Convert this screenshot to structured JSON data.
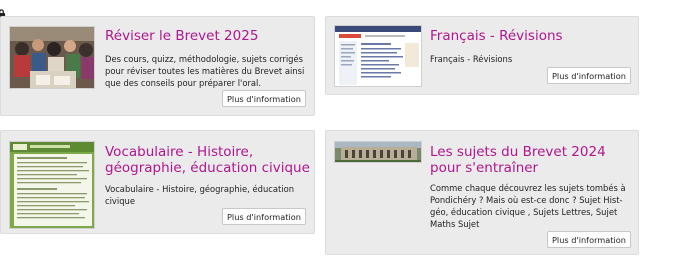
{
  "cards": [
    {
      "title": "Réviser le Brevet 2025",
      "description": "Des cours, quizz, méthodologie, sujets corrigés pour réviser toutes les matières du Brevet ainsi que des conseils pour préparer l'oral.",
      "button": "Plus d'information",
      "thumbnail": "photo-students-group"
    },
    {
      "title": "Français - Révisions",
      "description": "Français - Révisions",
      "button": "Plus d'information",
      "thumbnail": "website-screenshot"
    },
    {
      "title": "Vocabulaire - Histoire, géographie, éducation civique",
      "description": "Vocabulaire - Histoire, géographie, éducation civique",
      "button": "Plus d'information",
      "thumbnail": "green-document-page"
    },
    {
      "title": "Les sujets du Brevet 2024 pour s'entraîner",
      "description": "Comme chaque découvrez les sujets tombés à Pondichéry ? Mais où est-ce donc ? Sujet Hist-géo, éducation civique ,   Sujets Lettres,  Sujet Maths Sujet",
      "button": "Plus d'information",
      "thumbnail": "building-photo"
    }
  ],
  "colors": {
    "title": "#b0168f",
    "card_bg": "#ebebeb"
  }
}
